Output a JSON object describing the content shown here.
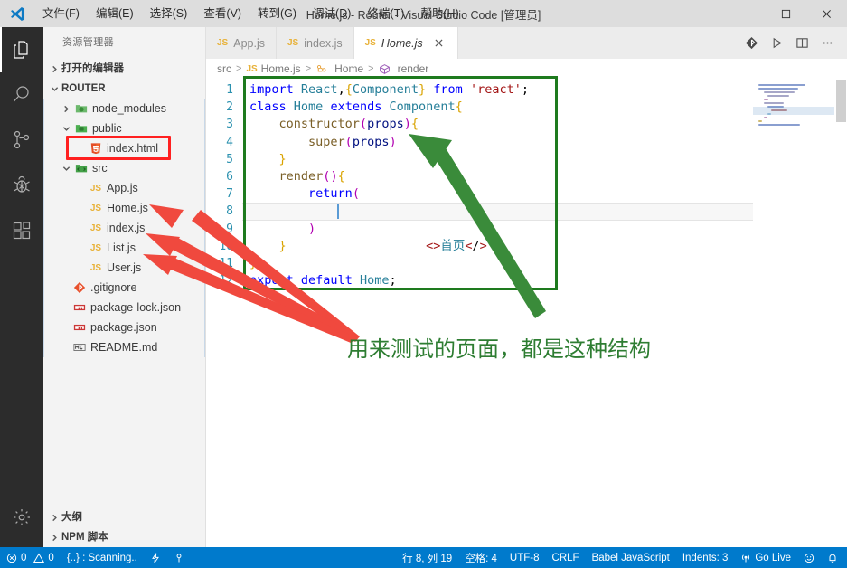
{
  "window": {
    "title": "Home.js - Router - Visual Studio Code [管理员]",
    "logo": "vscode-logo"
  },
  "menubar": {
    "items": [
      {
        "label": "文件(F)",
        "name": "menu-file"
      },
      {
        "label": "编辑(E)",
        "name": "menu-edit"
      },
      {
        "label": "选择(S)",
        "name": "menu-selection"
      },
      {
        "label": "查看(V)",
        "name": "menu-view"
      },
      {
        "label": "转到(G)",
        "name": "menu-goto"
      },
      {
        "label": "调试(D)",
        "name": "menu-debug"
      },
      {
        "label": "终端(T)",
        "name": "menu-terminal"
      },
      {
        "label": "帮助(H)",
        "name": "menu-help"
      }
    ]
  },
  "window_controls": [
    {
      "name": "minimize-button",
      "icon": "minimize-icon"
    },
    {
      "name": "maximize-button",
      "icon": "maximize-icon"
    },
    {
      "name": "close-button",
      "icon": "close-icon"
    }
  ],
  "activitybar": {
    "items": [
      {
        "name": "activity-explorer",
        "icon": "files-icon",
        "active": true
      },
      {
        "name": "activity-search",
        "icon": "search-icon",
        "active": false
      },
      {
        "name": "activity-source-control",
        "icon": "source-control-icon",
        "active": false
      },
      {
        "name": "activity-debug",
        "icon": "debug-icon",
        "active": false
      },
      {
        "name": "activity-extensions",
        "icon": "extensions-icon",
        "active": false
      }
    ],
    "bottom": [
      {
        "name": "activity-settings",
        "icon": "gear-icon"
      }
    ]
  },
  "sidebar": {
    "title": "资源管理器",
    "open_editors": {
      "label": "打开的编辑器",
      "expanded": false
    },
    "project": {
      "label": "ROUTER",
      "expanded": true
    },
    "tree": [
      {
        "label": "node_modules",
        "icon": "folder-node-modules-icon",
        "indent": 1,
        "twisty": "collapsed"
      },
      {
        "label": "public",
        "icon": "folder-public-icon",
        "indent": 1,
        "twisty": "expanded"
      },
      {
        "label": "index.html",
        "icon": "html5-icon",
        "indent": 2,
        "twisty": "none",
        "highlight": "red-box"
      },
      {
        "label": "src",
        "icon": "folder-src-icon",
        "indent": 1,
        "twisty": "expanded"
      },
      {
        "label": "App.js",
        "icon": "js-icon",
        "indent": 2,
        "twisty": "none"
      },
      {
        "label": "Home.js",
        "icon": "js-icon",
        "indent": 2,
        "twisty": "none"
      },
      {
        "label": "index.js",
        "icon": "js-icon",
        "indent": 2,
        "twisty": "none"
      },
      {
        "label": "List.js",
        "icon": "js-icon",
        "indent": 2,
        "twisty": "none"
      },
      {
        "label": "User.js",
        "icon": "js-icon",
        "indent": 2,
        "twisty": "none"
      },
      {
        "label": ".gitignore",
        "icon": "git-icon",
        "indent": 1,
        "twisty": "none"
      },
      {
        "label": "package-lock.json",
        "icon": "npm-icon",
        "indent": 1,
        "twisty": "none"
      },
      {
        "label": "package.json",
        "icon": "npm-icon",
        "indent": 1,
        "twisty": "none"
      },
      {
        "label": "README.md",
        "icon": "markdown-icon",
        "indent": 1,
        "twisty": "none"
      }
    ],
    "bottom_sections": [
      {
        "label": "大纲",
        "name": "sidebar-section-outline"
      },
      {
        "label": "NPM 脚本",
        "name": "sidebar-section-npm-scripts"
      }
    ]
  },
  "tabs": [
    {
      "label": "App.js",
      "icon": "js-icon",
      "active": false
    },
    {
      "label": "index.js",
      "icon": "js-icon",
      "active": false
    },
    {
      "label": "Home.js",
      "icon": "js-icon",
      "active": true,
      "close": "close-icon"
    }
  ],
  "editor_actions": [
    {
      "name": "git-action-icon",
      "icon": "git-icon"
    },
    {
      "name": "run-file-button",
      "icon": "play-icon"
    },
    {
      "name": "split-editor-button",
      "icon": "split-editor-icon"
    },
    {
      "name": "more-actions-button",
      "icon": "ellipsis-icon"
    }
  ],
  "breadcrumb": [
    {
      "label": "src",
      "icon": "none"
    },
    {
      "label": "Home.js",
      "icon": "js-icon"
    },
    {
      "label": "Home",
      "icon": "class-icon"
    },
    {
      "label": "render",
      "icon": "method-icon"
    }
  ],
  "code": {
    "lines": [
      {
        "n": "1",
        "text": "import React,{Component} from 'react';"
      },
      {
        "n": "2",
        "text": "class Home extends Component{"
      },
      {
        "n": "3",
        "text": "    constructor(props){"
      },
      {
        "n": "4",
        "text": "        super(props)"
      },
      {
        "n": "5",
        "text": "    }"
      },
      {
        "n": "6",
        "text": "    render(){"
      },
      {
        "n": "7",
        "text": "        return("
      },
      {
        "n": "8",
        "text": "            <>首页</>",
        "current": true
      },
      {
        "n": "9",
        "text": "        )"
      },
      {
        "n": "10",
        "text": "    }"
      },
      {
        "n": "11",
        "text": "}"
      },
      {
        "n": "12",
        "text": "export default Home;"
      }
    ]
  },
  "statusbar": {
    "left": [
      {
        "name": "status-problems",
        "icon": "error-warning-icon",
        "errors": "0",
        "warnings": "0"
      },
      {
        "name": "status-scanning",
        "label": "{..} : Scanning.."
      },
      {
        "name": "status-live-share",
        "icon": "live-share-icon"
      },
      {
        "name": "status-ports",
        "icon": "ports-icon"
      }
    ],
    "right": [
      {
        "name": "status-cursor-position",
        "label": "行 8, 列 19"
      },
      {
        "name": "status-indentation",
        "label": "空格: 4"
      },
      {
        "name": "status-encoding",
        "label": "UTF-8"
      },
      {
        "name": "status-eol",
        "label": "CRLF"
      },
      {
        "name": "status-language-mode",
        "label": "Babel JavaScript"
      },
      {
        "name": "status-indents",
        "label": "Indents: 3"
      },
      {
        "name": "status-go-live",
        "label": "Go Live",
        "icon": "broadcast-icon"
      },
      {
        "name": "status-feedback",
        "icon": "smiley-icon"
      },
      {
        "name": "status-notifications",
        "icon": "bell-icon"
      }
    ]
  },
  "annotations": {
    "note_text": "用来测试的页面，都是这种结构",
    "colors": {
      "red": "#ff2020",
      "green": "#1e7a1e",
      "accent": "#007acc"
    }
  }
}
